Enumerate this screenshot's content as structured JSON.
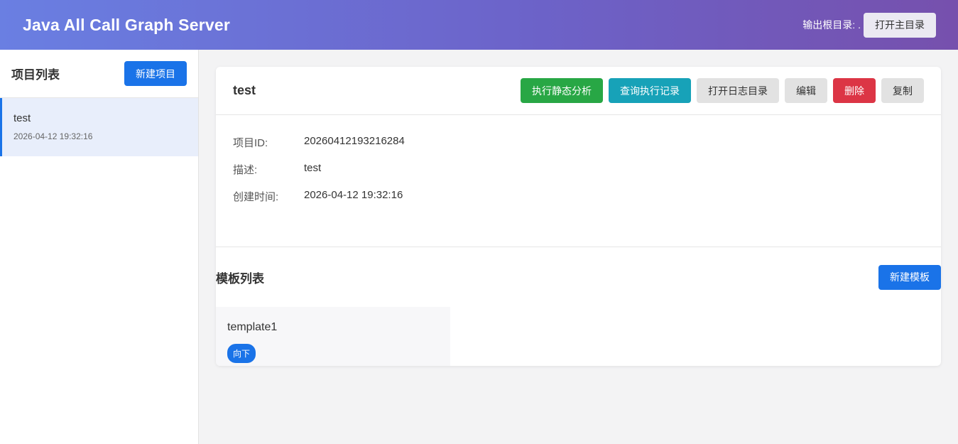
{
  "header": {
    "title": "Java All Call Graph Server",
    "output_root_label": "输出根目录:",
    "output_root_value": ".",
    "open_root_button": "打开主目录"
  },
  "sidebar": {
    "title": "项目列表",
    "new_project_button": "新建项目",
    "projects": [
      {
        "name": "test",
        "time": "2026-04-12 19:32:16"
      }
    ]
  },
  "project": {
    "name": "test",
    "actions": {
      "run_static": "执行静态分析",
      "query_records": "查询执行记录",
      "open_log_dir": "打开日志目录",
      "edit": "编辑",
      "delete": "删除",
      "copy": "复制"
    },
    "info": [
      {
        "key": "项目ID:",
        "value": "20260412193216284"
      },
      {
        "key": "描述:",
        "value": "test"
      },
      {
        "key": "创建时间:",
        "value": "2026-04-12 19:32:16"
      }
    ]
  },
  "templates": {
    "title": "模板列表",
    "new_template_button": "新建模板",
    "items": [
      {
        "name": "template1",
        "badge": "向下"
      }
    ]
  }
}
